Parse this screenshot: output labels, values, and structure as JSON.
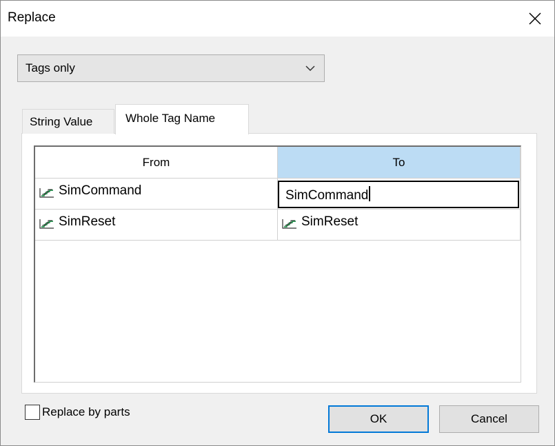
{
  "dialog": {
    "title": "Replace"
  },
  "scope_select": {
    "selected": "Tags only"
  },
  "tabs": [
    {
      "label": "String Value",
      "selected": false
    },
    {
      "label": "Whole Tag Name",
      "selected": true
    }
  ],
  "grid": {
    "columns": [
      "From",
      "To"
    ],
    "rows": [
      {
        "from": "SimCommand",
        "to": "SimCommand",
        "editing": true
      },
      {
        "from": "SimReset",
        "to": "SimReset",
        "editing": false
      }
    ],
    "selected_header_color": "#bcdcf4",
    "tag_icon": "tag-trend-icon"
  },
  "options": {
    "replace_by_parts_label": "Replace by parts",
    "replace_by_parts_checked": false
  },
  "buttons": {
    "ok_label": "OK",
    "cancel_label": "Cancel",
    "default_border_color": "#0078d7"
  }
}
